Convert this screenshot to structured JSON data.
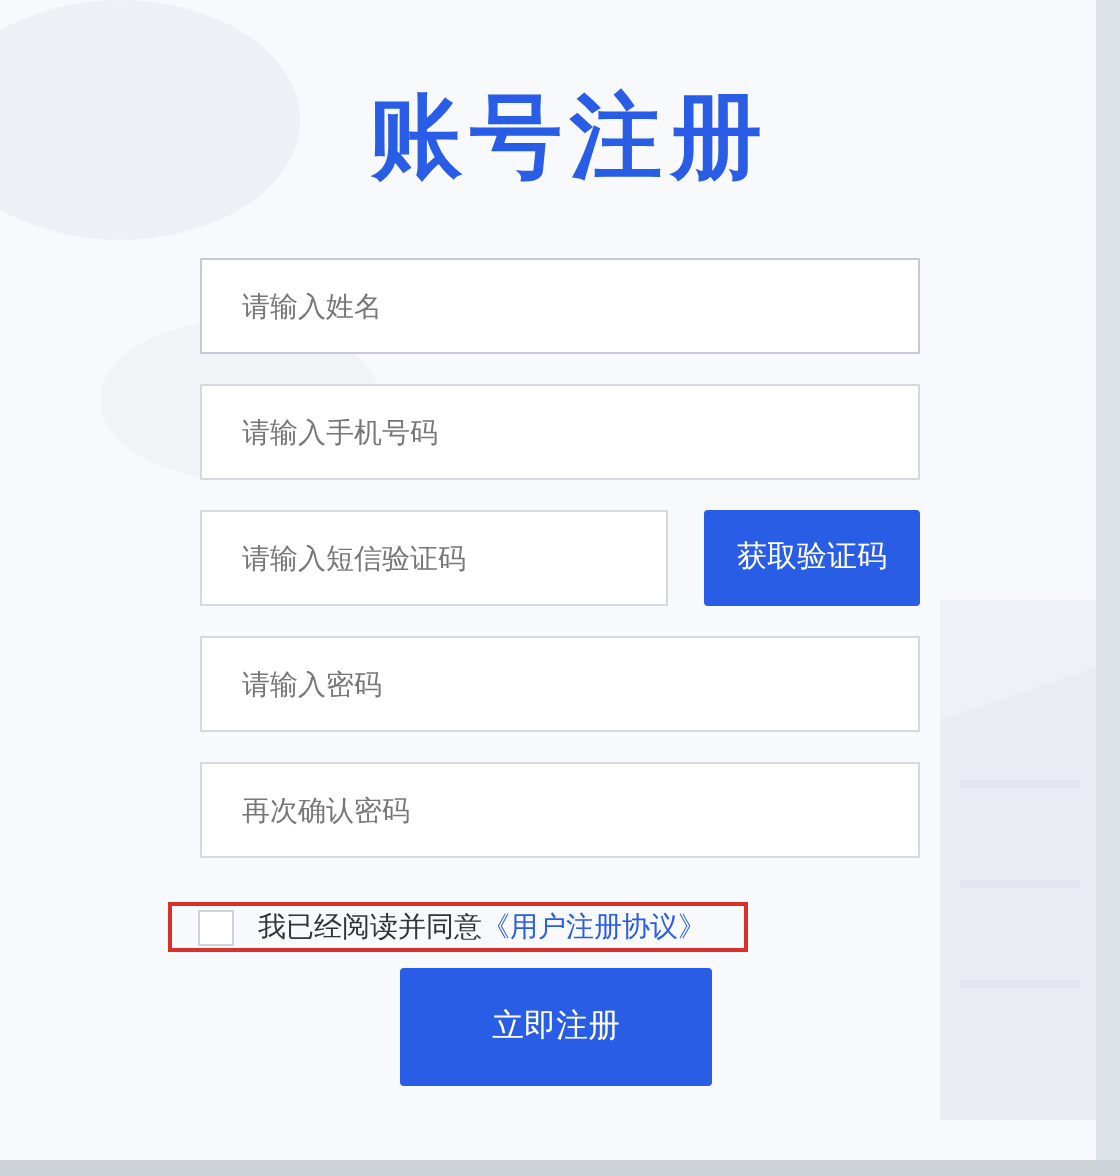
{
  "title": "账号注册",
  "fields": [
    {
      "kind": "text",
      "placeholder": "请输入姓名",
      "focused": true
    },
    {
      "kind": "text",
      "placeholder": "请输入手机号码",
      "focused": false
    },
    {
      "kind": "code",
      "placeholder": "请输入短信验证码",
      "focused": false,
      "button": "获取验证码"
    },
    {
      "kind": "text",
      "placeholder": "请输入密码",
      "focused": false
    },
    {
      "kind": "text",
      "placeholder": "再次确认密码",
      "focused": false
    }
  ],
  "agreement": {
    "checked": false,
    "highlighted": true,
    "text": "我已经阅读并同意",
    "link": "《用户注册协议》"
  },
  "submit": "立即注册"
}
